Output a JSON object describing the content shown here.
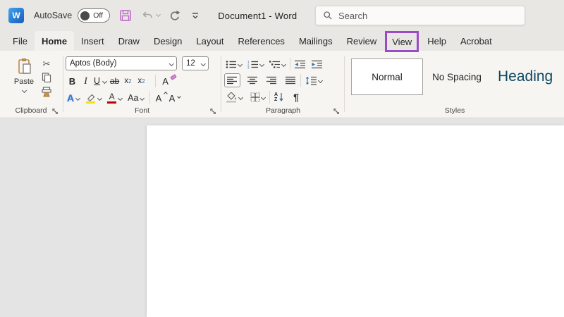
{
  "titlebar": {
    "autosave_label": "AutoSave",
    "autosave_state": "Off",
    "doc_title": "Document1  -  Word",
    "search_placeholder": "Search"
  },
  "tabs": [
    "File",
    "Home",
    "Insert",
    "Draw",
    "Design",
    "Layout",
    "References",
    "Mailings",
    "Review",
    "View",
    "Help",
    "Acrobat"
  ],
  "active_tab": "Home",
  "highlighted_tab": "View",
  "ribbon": {
    "clipboard": {
      "label": "Clipboard",
      "paste_label": "Paste"
    },
    "font": {
      "label": "Font",
      "font_name": "Aptos (Body)",
      "font_size": "12",
      "bold": "B",
      "italic": "I",
      "underline": "U",
      "strikethrough": "ab",
      "subscript_base": "x",
      "subscript_digit": "2",
      "superscript_base": "x",
      "superscript_digit": "2",
      "clear_formatting": "A",
      "text_effects": "A",
      "font_color": "A",
      "change_case": "Aa",
      "grow_font": "A",
      "shrink_font": "A"
    },
    "paragraph": {
      "label": "Paragraph",
      "sort_a": "A",
      "sort_z": "Z",
      "pilcrow": "¶"
    },
    "styles": {
      "label": "Styles",
      "items": [
        "Normal",
        "No Spacing",
        "Heading"
      ]
    }
  },
  "colors": {
    "annotation_purple": "#9B4BC8",
    "heading_blue": "#0F4761",
    "save_pink": "#BD6FC8",
    "highlight_yellow": "#F3E11A",
    "font_color_red": "#C00000"
  }
}
